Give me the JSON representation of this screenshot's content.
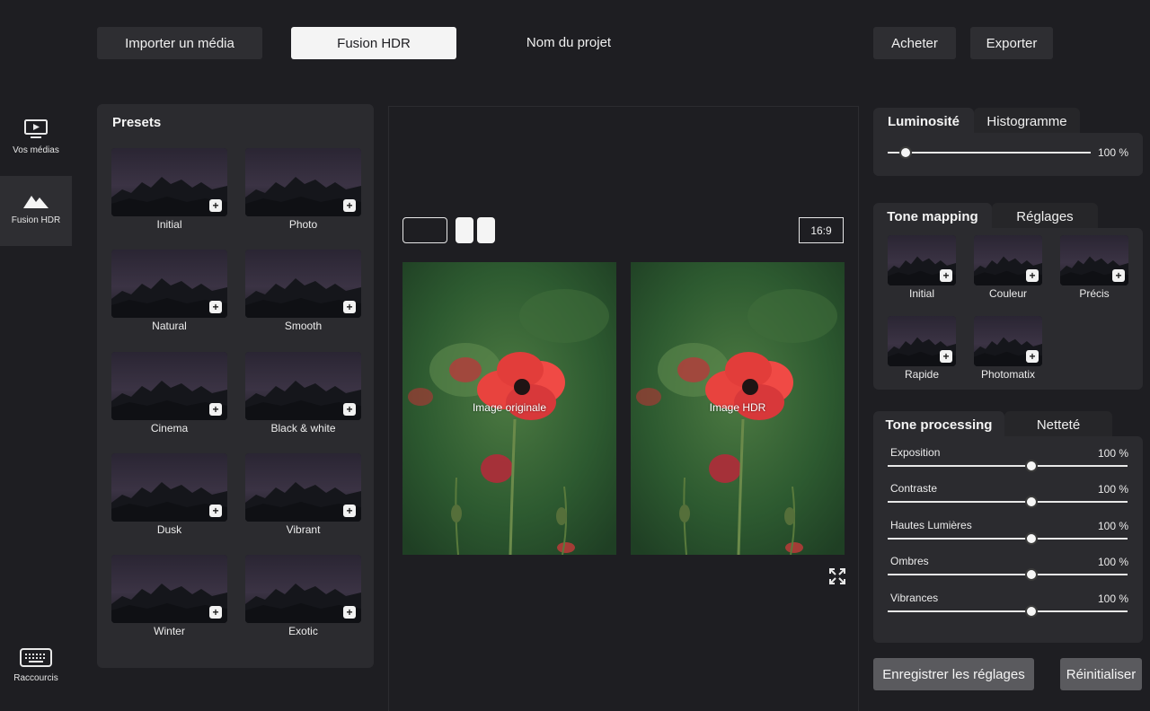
{
  "toolbar": {
    "import_label": "Importer un média",
    "hdr_label": "Fusion HDR",
    "project_name": "Nom du projet",
    "buy_label": "Acheter",
    "export_label": "Exporter"
  },
  "sidebar": {
    "items": [
      {
        "label": "Vos médias",
        "icon": "monitor-play-icon"
      },
      {
        "label": "Fusion HDR",
        "icon": "mountain-icon"
      },
      {
        "label": "Raccourcis",
        "icon": "keyboard-icon"
      }
    ]
  },
  "presets": {
    "title": "Presets",
    "items": [
      "Initial",
      "Photo",
      "Natural",
      "Smooth",
      "Cinema",
      "Black & white",
      "Dusk",
      "Vibrant",
      "Winter",
      "Exotic"
    ],
    "add_symbol": "+"
  },
  "preview": {
    "ratio": "16:9",
    "original_label": "Image originale",
    "hdr_label": "Image HDR"
  },
  "luminosity": {
    "tab_active": "Luminosité",
    "tab_inactive": "Histogramme",
    "value_text": "100 %",
    "level": 0.09
  },
  "tone_mapping": {
    "tab_active": "Tone mapping",
    "tab_inactive": "Réglages",
    "items": [
      "Initial",
      "Couleur",
      "Précis",
      "Rapide",
      "Photomatix"
    ]
  },
  "tone_processing": {
    "tab_active": "Tone processing",
    "tab_inactive": "Netteté",
    "sliders": [
      {
        "name": "Exposition",
        "value_text": "100 %",
        "level": 0.6
      },
      {
        "name": "Contraste",
        "value_text": "100 %",
        "level": 0.6
      },
      {
        "name": "Hautes Lumières",
        "value_text": "100 %",
        "level": 0.6
      },
      {
        "name": "Ombres",
        "value_text": "100 %",
        "level": 0.6
      },
      {
        "name": "Vibrances",
        "value_text": "100 %",
        "level": 0.6
      }
    ]
  },
  "footer": {
    "save_label": "Enregistrer les réglages",
    "reset_label": "Réinitialiser"
  },
  "colors": {
    "background": "#1e1e22",
    "panel": "#2b2b2f",
    "button": "#2e2e32",
    "accent_light": "#f4f4f4"
  }
}
